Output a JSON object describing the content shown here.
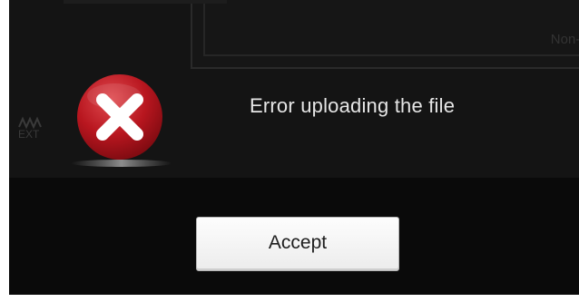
{
  "background": {
    "panel_label": "Non-linear",
    "side_label": "EXT"
  },
  "dialog": {
    "icon": "error-x-icon",
    "message": "Error uploading the file",
    "accept_label": "Accept"
  },
  "colors": {
    "dialog_bg": "#141414",
    "footer_bg": "#0a0a0a",
    "error_red": "#c8202a",
    "message_text": "#e6e6e6"
  }
}
